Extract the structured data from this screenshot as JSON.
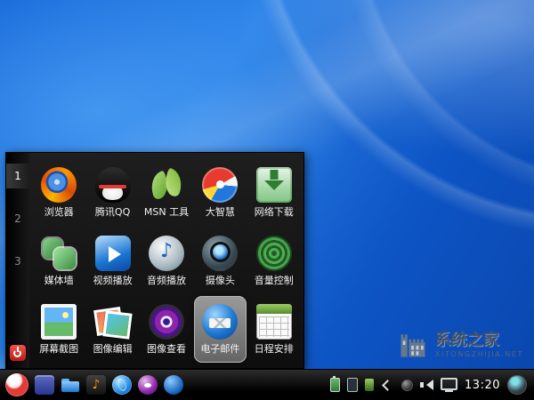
{
  "desktop": {
    "watermark": {
      "title": "系统之家",
      "subtitle": "XITONGZHIJIA.NET"
    }
  },
  "menu": {
    "pages": [
      "1",
      "2",
      "3"
    ],
    "active_page": "1",
    "selected_item": "电子邮件",
    "items": [
      {
        "label": "浏览器",
        "icon": "firefox-icon"
      },
      {
        "label": "腾讯QQ",
        "icon": "qq-icon"
      },
      {
        "label": "MSN 工具",
        "icon": "msn-icon"
      },
      {
        "label": "大智慧",
        "icon": "dazhihui-icon"
      },
      {
        "label": "网络下载",
        "icon": "download-icon"
      },
      {
        "label": "媒体墙",
        "icon": "mediawall-icon"
      },
      {
        "label": "视频播放",
        "icon": "video-player-icon"
      },
      {
        "label": "音频播放",
        "icon": "audio-player-icon"
      },
      {
        "label": "摄像头",
        "icon": "webcam-icon"
      },
      {
        "label": "音量控制",
        "icon": "volume-icon"
      },
      {
        "label": "屏幕截图",
        "icon": "screenshot-icon"
      },
      {
        "label": "图像编辑",
        "icon": "image-editor-icon"
      },
      {
        "label": "图像查看",
        "icon": "image-viewer-icon"
      },
      {
        "label": "电子邮件",
        "icon": "thunderbird-icon"
      },
      {
        "label": "日程安排",
        "icon": "calendar-icon"
      }
    ]
  },
  "taskbar": {
    "clock": "13:20"
  },
  "colors": {
    "desktop_blue": "#1467d8",
    "panel_black": "#141414",
    "highlight_gray": "#8a8a8a",
    "power_red": "#d32f2f"
  }
}
